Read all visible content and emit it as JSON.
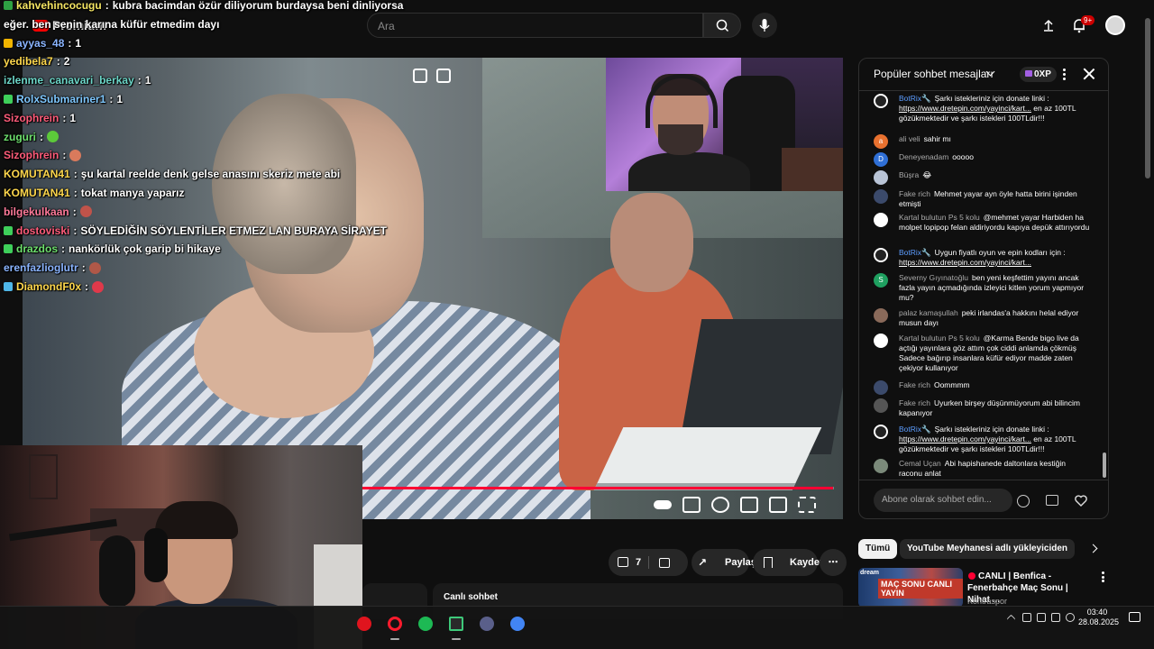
{
  "brand": {
    "logo_label": "Premium"
  },
  "search": {
    "placeholder": "Ara"
  },
  "header": {
    "notification_badge": "9+"
  },
  "chat_overlay": [
    {
      "author": "kahvehincocugu",
      "message": "kubra bacimdan özür diliyorum burdaysa beni dinliyorsa",
      "author_color": "#f5e663",
      "badge_color": "#2ea043"
    },
    {
      "author": "",
      "message": "eğer. ben senin karına küfür etmedim dayı",
      "author_color": "#ffffff",
      "badge_color": ""
    },
    {
      "author": "ayyas_48",
      "message": "1",
      "author_color": "#8ab4ff",
      "badge_color": "#f0b400"
    },
    {
      "author": "yedibela7",
      "message": "2",
      "author_color": "#ffd84d",
      "badge_color": ""
    },
    {
      "author": "izlenme_canavari_berkay",
      "message": "1",
      "author_color": "#6cd6c8",
      "badge_color": ""
    },
    {
      "author": "RolxSubmariner1",
      "message": "1",
      "author_color": "#7fc8ff",
      "badge_color": "#3ecf5a"
    },
    {
      "author": "Sizophrein",
      "message": "1",
      "author_color": "#ff5c7a",
      "badge_color": ""
    },
    {
      "author": "zuguri",
      "message": "",
      "author_color": "#6ee06e",
      "badge_color": "",
      "emote": "#5cc93a"
    },
    {
      "author": "Sizophrein",
      "message": "",
      "author_color": "#ff5c7a",
      "badge_color": "",
      "emote": "#d97a5c"
    },
    {
      "author": "KOMUTAN41",
      "message": "şu kartal reelde denk gelse anasını skeriz mete abi",
      "author_color": "#ffd84d",
      "badge_color": ""
    },
    {
      "author": "KOMUTAN41",
      "message": "tokat manya yaparız",
      "author_color": "#ffd84d",
      "badge_color": ""
    },
    {
      "author": "bilgekulkaan",
      "message": "",
      "author_color": "#ff7a9a",
      "badge_color": "",
      "emote": "#c0534a"
    },
    {
      "author": "dostoviski",
      "message": "SÖYLEDİĞİN SÖYLENTİLER ETMEZ LAN BURAYA SİRAYET",
      "author_color": "#ff5c7a",
      "badge_color": "#3ecf5a"
    },
    {
      "author": "drazdos",
      "message": "nankörlük çok garip bi hikaye",
      "author_color": "#6ee06e",
      "badge_color": "#3ecf5a"
    },
    {
      "author": "erenfazlioglutr",
      "message": "",
      "author_color": "#8ab4ff",
      "badge_color": "",
      "emote": "#b05848"
    },
    {
      "author": "DiamondF0x",
      "message": "",
      "author_color": "#ffd84d",
      "badge_color": "#4fb7e8",
      "emote": "#e0394a"
    }
  ],
  "chat_panel": {
    "title": "Popüler sohbet mesajları",
    "xp": "0XP",
    "input_placeholder": "Abone olarak sohbet edin...",
    "messages": [
      {
        "author": "BotRix🔧",
        "is_bot": true,
        "text": "Şarkı istekleriniz için donate linki : ",
        "link": "https://www.dretepin.com/yayinci/kart...",
        "text_after": " en az 100TL gözükmektedir ve şarkı istekleri 100TLdir!!!",
        "avatar_color": "#ffffff",
        "avatar_initial": ""
      },
      {
        "author": "ali veli",
        "is_bot": false,
        "text": "sahir mı",
        "link": "",
        "text_after": "",
        "avatar_color": "#e8712f",
        "avatar_initial": "a"
      },
      {
        "author": "Deneyenadam",
        "is_bot": false,
        "text": "ooooo",
        "link": "",
        "text_after": "",
        "avatar_color": "#2f6fd6",
        "avatar_initial": "D"
      },
      {
        "author": "Büşra",
        "is_bot": false,
        "text": "😂",
        "link": "",
        "text_after": "",
        "avatar_color": "#b9c4d6",
        "avatar_initial": ""
      },
      {
        "author": "Fake rich",
        "is_bot": false,
        "text": "Mehmet yayar ayn öyle hatta birini işinden etmişti",
        "link": "",
        "text_after": "",
        "avatar_color": "#3b4a6b",
        "avatar_initial": ""
      },
      {
        "author": "Kartal bulutun Ps 5 kolu",
        "is_bot": false,
        "text": "@mehmet yayar Harbiden ha molpet lopipop felan aldiriyordu kapıya depük attırıyordu",
        "link": "",
        "text_after": "",
        "avatar_color": "#ffffff",
        "avatar_initial": ""
      },
      {
        "author": "BotRix🔧",
        "is_bot": true,
        "text": "Uygun fiyatlı oyun ve epin kodları için : ",
        "link": "https://www.dretepin.com/yayinci/kart...",
        "text_after": "",
        "avatar_color": "#ffffff",
        "avatar_initial": ""
      },
      {
        "author": "Severny Gıyınatoğlu",
        "is_bot": false,
        "text": "ben yeni keşfettim yayını ancak fazla yayın açmadığında izleyici kitlen yorum yapmıyor mu?",
        "link": "",
        "text_after": "",
        "avatar_color": "#1fa060",
        "avatar_initial": "S"
      },
      {
        "author": "palaz kamaşullah",
        "is_bot": false,
        "text": "peki irlandas'a hakkını helal ediyor musun dayı",
        "link": "",
        "text_after": "",
        "avatar_color": "#8a6a5a",
        "avatar_initial": ""
      },
      {
        "author": "Kartal bulutun Ps 5 kolu",
        "is_bot": false,
        "text": "@Karma Bende bigo live da açtığı yayınlara göz attım çok ciddi anlamda çökmüş Sadece bağırıp insanlara küfür ediyor madde zaten çekiyor kullanıyor",
        "link": "",
        "text_after": "",
        "avatar_color": "#ffffff",
        "avatar_initial": ""
      },
      {
        "author": "Fake rich",
        "is_bot": false,
        "text": "Oommmm",
        "link": "",
        "text_after": "",
        "avatar_color": "#3b4a6b",
        "avatar_initial": ""
      },
      {
        "author": "Fake rich",
        "is_bot": false,
        "text": "Uyurken birşey düşünmüyorum abi bilincim kapanıyor",
        "link": "",
        "text_after": "",
        "avatar_color": "",
        "avatar_initial": ""
      },
      {
        "author": "BotRix🔧",
        "is_bot": true,
        "text": "Şarkı istekleriniz için donate linki : ",
        "link": "https://www.dretepin.com/yayinci/kart...",
        "text_after": " en az 100TL gözükmektedir ve şarkı istekleri 100TLdir!!!",
        "avatar_color": "#ffffff",
        "avatar_initial": ""
      },
      {
        "author": "Cemal Uçan",
        "is_bot": false,
        "text": "Abi hapishanede daltonlara kestiğin raconu anlat",
        "link": "",
        "text_after": "",
        "avatar_color": "#7b8a7a",
        "avatar_initial": ""
      }
    ]
  },
  "actions": {
    "likes": "7",
    "share": "Paylaş",
    "save": "Kaydet"
  },
  "below_video": {
    "live_chat_label": "Canlı sohbet"
  },
  "recommendations": {
    "chips": [
      "Tümü",
      "YouTube Meyhanesi adlı yükleyiciden"
    ],
    "item": {
      "title": "CANLI | Benfica - Fenerbahçe Maç Sonu | Nihat ...",
      "channel": "Kontraspor",
      "thumb_line1": "dream",
      "thumb_line2": "MAÇ SONU CANLI YAYIN"
    }
  },
  "video": {
    "progress_fraction": 0.999
  },
  "taskbar": {
    "apps": [
      {
        "name": "opera-gx-app",
        "color": "#e0141e"
      },
      {
        "name": "opera-app",
        "color": "#ff1b2d"
      },
      {
        "name": "spotify-app",
        "color": "#1db954"
      },
      {
        "name": "terminal-app",
        "color": "#2a2a2a"
      },
      {
        "name": "media-app",
        "color": "#5a5f8a"
      },
      {
        "name": "chrome-app",
        "color": "#4285f4"
      }
    ],
    "time": "03:40",
    "date": "28.08.2025"
  }
}
